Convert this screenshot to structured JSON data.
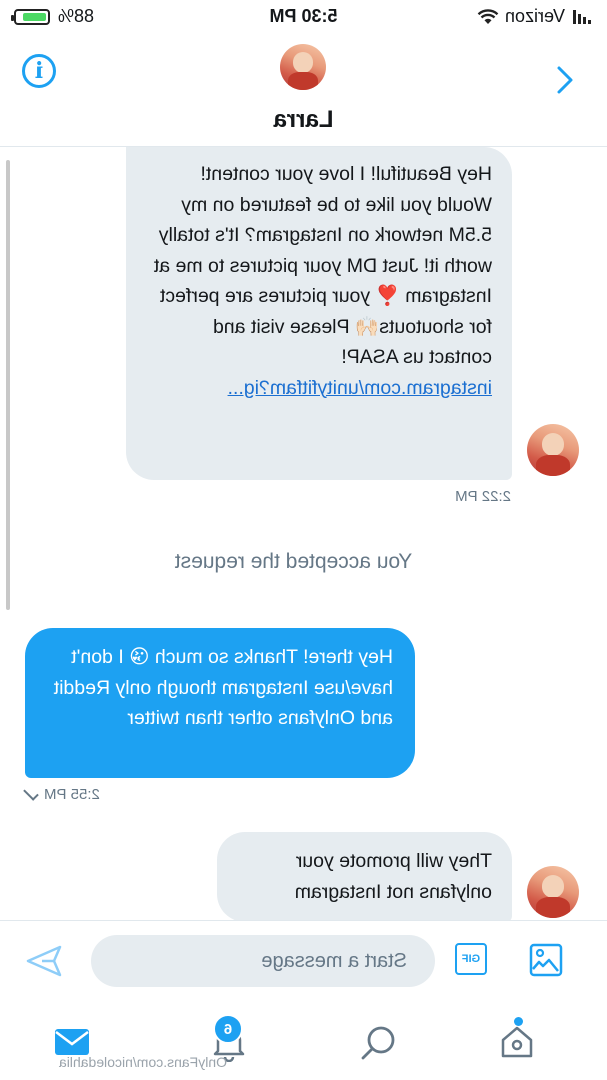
{
  "status_bar": {
    "carrier": "Verizon",
    "time": "5:30 PM",
    "battery": "88%",
    "battery_level": 0.88
  },
  "header": {
    "name": "Larra",
    "avatar": "contact-avatar"
  },
  "messages": [
    {
      "direction": "incoming",
      "text": "Hey Beautiful! I love your content! Would you like to be featured on my 5.5M network on Instagram? It's totally worth it! Just DM your pictures to me at Instagram ❣️ your pictures are perfect for shoutouts🙌🏻 Please visit and contact us ASAP!",
      "link": "instagram.com/unityfitfam?ig...",
      "time": "2:22 PM"
    },
    {
      "system": "You accepted the request"
    },
    {
      "direction": "outgoing",
      "text": "Hey there! Thanks so much 😘 I don't have/use Instagram though only Reddit and Onlyfans other than twitter",
      "time": "2:55 PM"
    },
    {
      "direction": "incoming",
      "text": "They will promote your onlyfans not Instagram"
    }
  ],
  "composer": {
    "placeholder": "Start a message",
    "gif_label": "GIF"
  },
  "tabbar": {
    "notifications_badge": "6"
  },
  "watermark": "OnlyFans.com/nicoledahlia",
  "colors": {
    "accent": "#1da1f2",
    "incoming_bubble": "#e6ecf0",
    "outgoing_bubble": "#1da1f2"
  }
}
